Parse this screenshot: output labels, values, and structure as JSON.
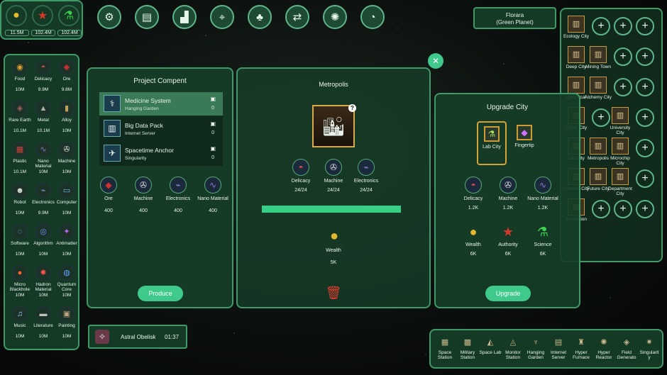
{
  "resources_top": [
    {
      "icon": "gold-coin-icon",
      "glyph": "●",
      "color": "#e3b92c",
      "value": "11.5M"
    },
    {
      "icon": "red-star-icon",
      "glyph": "★",
      "color": "#d43a2a",
      "value": "102.4M"
    },
    {
      "icon": "flask-icon",
      "glyph": "⚗",
      "color": "#3ccf4e",
      "value": "102.4M"
    }
  ],
  "toolbar": [
    {
      "name": "settings-button",
      "glyph": "⚙"
    },
    {
      "name": "codex-button",
      "glyph": "▤"
    },
    {
      "name": "statistics-button",
      "glyph": "▟"
    },
    {
      "name": "satellite-button",
      "glyph": "⌖"
    },
    {
      "name": "tree-button",
      "glyph": "♣"
    },
    {
      "name": "exchange-button",
      "glyph": "⇄"
    },
    {
      "name": "galaxy-button",
      "glyph": "✺"
    },
    {
      "name": "pie-chart-button",
      "glyph": "◔"
    }
  ],
  "materials": [
    {
      "name": "Food",
      "value": "10M",
      "glyph": "◉",
      "color": "#e0a030"
    },
    {
      "name": "Delicacy",
      "value": "9.9M",
      "glyph": "◓",
      "color": "#d05050"
    },
    {
      "name": "Ore",
      "value": "9.8M",
      "glyph": "◆",
      "color": "#c03030"
    },
    {
      "name": "Rare Earth",
      "value": "10.1M",
      "glyph": "◈",
      "color": "#9a6060"
    },
    {
      "name": "Metal",
      "value": "10.1M",
      "glyph": "▲",
      "color": "#b0b0b0"
    },
    {
      "name": "Alloy",
      "value": "10M",
      "glyph": "▮",
      "color": "#c0a060"
    },
    {
      "name": "Plastic",
      "value": "10.1M",
      "glyph": "▦",
      "color": "#d04040"
    },
    {
      "name": "Nano Material",
      "value": "10M",
      "glyph": "∿",
      "color": "#8a7ad0"
    },
    {
      "name": "Machine",
      "value": "10M",
      "glyph": "✇",
      "color": "#dddddd"
    },
    {
      "name": "Robot",
      "value": "10M",
      "glyph": "☻",
      "color": "#dddddd"
    },
    {
      "name": "Electronics",
      "value": "9.9M",
      "glyph": "⌁",
      "color": "#9a90e0"
    },
    {
      "name": "Computer",
      "value": "10M",
      "glyph": "▭",
      "color": "#70b0e0"
    },
    {
      "name": "Software",
      "value": "10M",
      "glyph": "◌",
      "color": "#80b8ff"
    },
    {
      "name": "Algorithm",
      "value": "10M",
      "glyph": "◎",
      "color": "#7090ff"
    },
    {
      "name": "Antimatter",
      "value": "10M",
      "glyph": "✦",
      "color": "#c060ff"
    },
    {
      "name": "Micro Blackhole",
      "value": "10M",
      "glyph": "●",
      "color": "#ff6030"
    },
    {
      "name": "Hadron Material",
      "value": "10M",
      "glyph": "✸",
      "color": "#ff5050"
    },
    {
      "name": "Quantum Core",
      "value": "10M",
      "glyph": "◍",
      "color": "#60a0ff"
    },
    {
      "name": "Music",
      "value": "10M",
      "glyph": "♫",
      "color": "#90c8ff"
    },
    {
      "name": "Literature",
      "value": "10M",
      "glyph": "▬",
      "color": "#c0c0c0"
    },
    {
      "name": "Painting",
      "value": "10M",
      "glyph": "▣",
      "color": "#c0a080"
    }
  ],
  "project": {
    "title": "Project Compent",
    "items": [
      {
        "name": "Medicine System",
        "sub": "Hanging Garden",
        "count": "0",
        "glyph": "⚕"
      },
      {
        "name": "Big Data Pack",
        "sub": "Internet Server",
        "count": "0",
        "glyph": "▥"
      },
      {
        "name": "Spacetime Anchor",
        "sub": "Singularity",
        "count": "0",
        "glyph": "✈"
      }
    ],
    "requirements": [
      {
        "name": "Ore",
        "value": "400",
        "glyph": "◆",
        "color": "#d03030"
      },
      {
        "name": "Machine",
        "value": "400",
        "glyph": "✇",
        "color": "#dddddd"
      },
      {
        "name": "Electronics",
        "value": "400",
        "glyph": "⌁",
        "color": "#9a90e0"
      },
      {
        "name": "Nano Material",
        "value": "400",
        "glyph": "∿",
        "color": "#8a7ad0"
      }
    ],
    "produce_label": "Produce"
  },
  "metropolis": {
    "title": "Metropolis",
    "inputs": [
      {
        "name": "Delicacy",
        "value": "24/24",
        "glyph": "◓",
        "color": "#d05050"
      },
      {
        "name": "Machine",
        "value": "24/24",
        "glyph": "✇",
        "color": "#dddddd"
      },
      {
        "name": "Electronics",
        "value": "24/24",
        "glyph": "⌁",
        "color": "#9a90e0"
      }
    ],
    "progress_fraction": 1.0,
    "output": {
      "name": "Wealth",
      "value": "5K"
    }
  },
  "upgrade": {
    "title": "Upgrade City",
    "options": [
      {
        "name": "Lab City",
        "glyph": "⚗",
        "color": "#b0e060",
        "selected": true
      },
      {
        "name": "Fingertip",
        "glyph": "◆",
        "color": "#d070ff",
        "selected": false
      }
    ],
    "costs": [
      {
        "name": "Delicacy",
        "value": "1.2K",
        "glyph": "◓",
        "color": "#d05050"
      },
      {
        "name": "Machine",
        "value": "1.2K",
        "glyph": "✇",
        "color": "#dddddd"
      },
      {
        "name": "Nano Material",
        "value": "1.2K",
        "glyph": "∿",
        "color": "#8a7ad0"
      },
      {
        "name": "Wealth",
        "value": "6K",
        "glyph": "●",
        "color": "#e3b92c"
      },
      {
        "name": "Authority",
        "value": "6K",
        "glyph": "★",
        "color": "#d43a2a"
      },
      {
        "name": "Science",
        "value": "6K",
        "glyph": "⚗",
        "color": "#3ccf4e"
      }
    ],
    "upgrade_label": "Upgrade"
  },
  "planet": {
    "name": "Florara",
    "type": "(Green Planet)"
  },
  "cities": [
    {
      "label": "Ecology City",
      "col": 0,
      "row": 0
    },
    {
      "label": "Deep City",
      "col": 0,
      "row": 1
    },
    {
      "label": "Mining Town",
      "col": 1,
      "row": 1
    },
    {
      "label": "Chemical",
      "col": 0,
      "row": 2
    },
    {
      "label": "Alchemy City",
      "col": 1,
      "row": 2
    },
    {
      "label": "Cyber City",
      "col": 0,
      "row": 3
    },
    {
      "label": "University City",
      "col": 2,
      "row": 3
    },
    {
      "label": "Lab City",
      "col": 0,
      "row": 4
    },
    {
      "label": "Metropolis",
      "col": 1,
      "row": 4
    },
    {
      "label": "Microchip City",
      "col": 2,
      "row": 4
    },
    {
      "label": "Furnace City",
      "col": 0,
      "row": 5
    },
    {
      "label": "Future City",
      "col": 1,
      "row": 5
    },
    {
      "label": "Department City",
      "col": 2,
      "row": 5
    },
    {
      "label": "Innovation",
      "col": 0,
      "row": 6
    }
  ],
  "timer": {
    "name": "Astral Obelisk",
    "time": "01:37"
  },
  "buildings": [
    {
      "name": "Space Station",
      "glyph": "▦"
    },
    {
      "name": "Military Station",
      "glyph": "▩"
    },
    {
      "name": "Space Lab",
      "glyph": "◭"
    },
    {
      "name": "Monitor Station",
      "glyph": "◬"
    },
    {
      "name": "Hanging Garden",
      "glyph": "♆"
    },
    {
      "name": "Internet Server",
      "glyph": "▤"
    },
    {
      "name": "Hyper Furnace",
      "glyph": "♜"
    },
    {
      "name": "Hyper Reactor",
      "glyph": "✺"
    },
    {
      "name": "Field Generato",
      "glyph": "◈"
    },
    {
      "name": "Singularit y",
      "glyph": "✷"
    }
  ]
}
